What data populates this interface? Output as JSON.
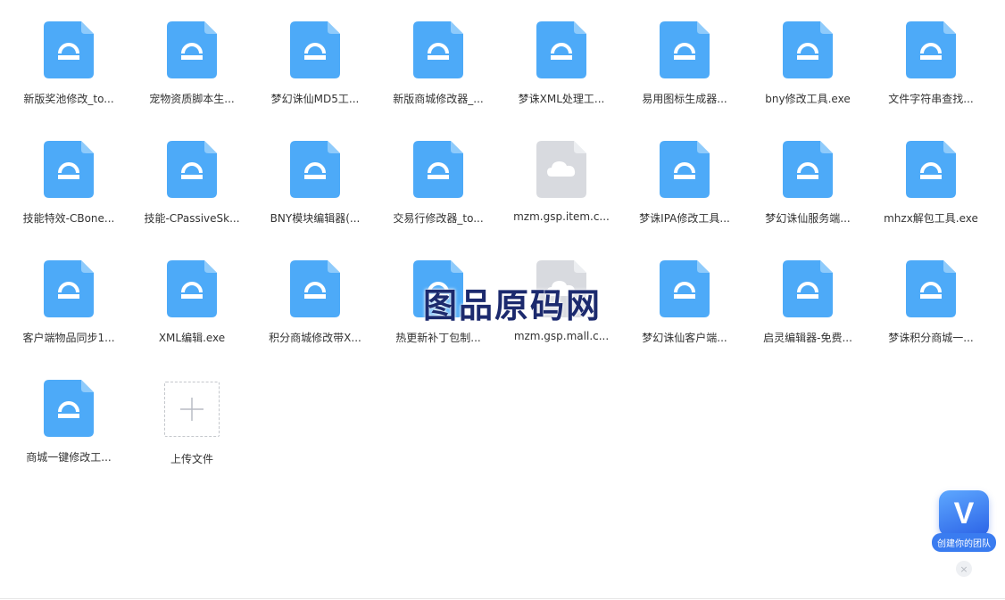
{
  "files": [
    {
      "name": "新版奖池修改_to...",
      "type": "exe"
    },
    {
      "name": "宠物资质脚本生...",
      "type": "exe"
    },
    {
      "name": "梦幻诛仙MD5工...",
      "type": "exe"
    },
    {
      "name": "新版商城修改器_...",
      "type": "exe"
    },
    {
      "name": "梦诛XML处理工...",
      "type": "exe"
    },
    {
      "name": "易用图标生成器...",
      "type": "exe"
    },
    {
      "name": "bny修改工具.exe",
      "type": "exe"
    },
    {
      "name": "文件字符串查找...",
      "type": "exe"
    },
    {
      "name": "技能特效-CBone...",
      "type": "exe"
    },
    {
      "name": "技能-CPassiveSk...",
      "type": "exe"
    },
    {
      "name": "BNY模块编辑器(...",
      "type": "exe"
    },
    {
      "name": "交易行修改器_to...",
      "type": "exe"
    },
    {
      "name": "mzm.gsp.item.c...",
      "type": "cloud"
    },
    {
      "name": "梦诛IPA修改工具...",
      "type": "exe"
    },
    {
      "name": "梦幻诛仙服务端...",
      "type": "exe"
    },
    {
      "name": "mhzx解包工具.exe",
      "type": "exe"
    },
    {
      "name": "客户端物品同步1...",
      "type": "exe"
    },
    {
      "name": "XML编辑.exe",
      "type": "exe"
    },
    {
      "name": "积分商城修改带X...",
      "type": "exe"
    },
    {
      "name": "热更新补丁包制...",
      "type": "exe"
    },
    {
      "name": "mzm.gsp.mall.c...",
      "type": "cloud"
    },
    {
      "name": "梦幻诛仙客户端...",
      "type": "exe"
    },
    {
      "name": "启灵编辑器-免费...",
      "type": "exe"
    },
    {
      "name": "梦诛积分商城一...",
      "type": "exe"
    },
    {
      "name": "商城一键修改工...",
      "type": "exe"
    }
  ],
  "upload": {
    "label": "上传文件",
    "icon": "plus-icon"
  },
  "watermark": {
    "text": "图品原码网"
  },
  "team_widget": {
    "badge_letter": "V",
    "label": "创建你的团队",
    "close": "×",
    "icon": "team-v-badge-icon"
  },
  "colors": {
    "exe_icon": "#4daaf8",
    "cloud_icon": "#d8dadf",
    "accent": "#3a7cf0",
    "text": "#333333"
  }
}
